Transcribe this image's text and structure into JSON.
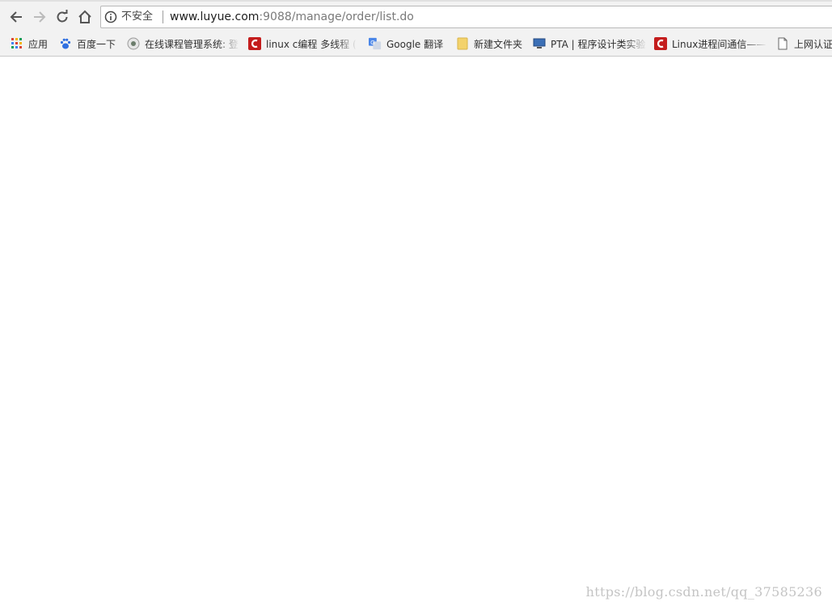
{
  "browser": {
    "omnibox": {
      "security_label": "不安全",
      "url_host": "www.luyue.com",
      "url_path": ":9088/manage/order/list.do"
    },
    "icons": {
      "back": "back-arrow-icon",
      "forward": "forward-arrow-icon",
      "reload": "reload-icon",
      "home": "home-icon",
      "info": "info-circle-icon"
    }
  },
  "bookmarks": [
    {
      "label": "应用",
      "icon": "apps-grid-icon"
    },
    {
      "label": "百度一下",
      "icon": "baidu-paw-icon"
    },
    {
      "label": "在线课程管理系统: 登",
      "icon": "course-logo-icon"
    },
    {
      "label": "linux c编程 多线程 (",
      "icon": "csdn-icon",
      "accent": "#c41d1d"
    },
    {
      "label": "Google 翻译",
      "icon": "google-translate-icon",
      "accent": "#4a86e8"
    },
    {
      "label": "新建文件夹",
      "icon": "folder-icon",
      "accent": "#f3d26b"
    },
    {
      "label": "PTA | 程序设计类实验",
      "icon": "monitor-icon"
    },
    {
      "label": "Linux进程间通信——",
      "icon": "csdn-icon",
      "accent": "#c41d1d"
    },
    {
      "label": "上网认证",
      "icon": "page-icon"
    }
  ],
  "watermark": "https://blog.csdn.net/qq_37585236"
}
